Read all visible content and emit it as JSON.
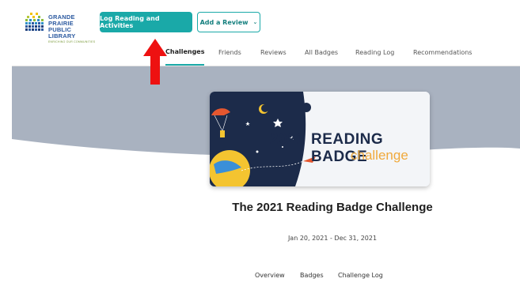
{
  "logo": {
    "line1": "GRANDE PRAIRIE",
    "line2": "PUBLIC LIBRARY",
    "line3": "ENRICHING OUR COMMUNITIES"
  },
  "header": {
    "log_button": "Log Reading and Activities",
    "review_button": "Add a Review"
  },
  "tabs": [
    {
      "label": "Challenges",
      "active": true
    },
    {
      "label": "Friends"
    },
    {
      "label": "Reviews"
    },
    {
      "label": "All Badges"
    },
    {
      "label": "Reading Log"
    },
    {
      "label": "Recommendations"
    }
  ],
  "badge": {
    "year": "2021",
    "word": "READING BADGE",
    "subword": "challenge"
  },
  "challenge": {
    "title": "The 2021 Reading Badge Challenge",
    "dates": "Jan 20, 2021 - Dec 31, 2021"
  },
  "subtabs": [
    {
      "label": "Overview",
      "active": true
    },
    {
      "label": "Badges"
    },
    {
      "label": "Challenge Log"
    }
  ],
  "colors": {
    "accent": "#1aa9a8",
    "hero_gray": "#a8b1bf",
    "arrow": "#ee1111"
  }
}
